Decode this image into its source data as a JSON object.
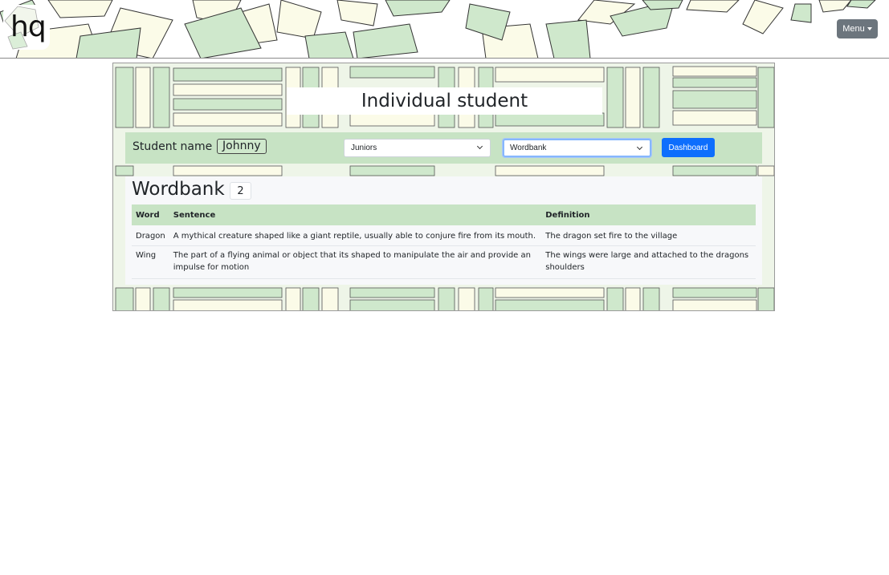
{
  "header": {
    "logo_text": "hq",
    "menu_label": "Menu"
  },
  "page": {
    "title": "Individual student"
  },
  "controls": {
    "student_label": "Student name :",
    "student_name": "Johnny",
    "group_select": "Juniors",
    "view_select": "Wordbank",
    "dashboard_label": "Dashboard"
  },
  "wordbank": {
    "title": "Wordbank",
    "count": "2",
    "columns": [
      "Word",
      "Sentence",
      "Definition"
    ],
    "rows": [
      {
        "word": "Dragon",
        "sentence": "A mythical creature shaped like a giant reptile, usually able to conjure fire from its mouth.",
        "definition": "The dragon set fire to the village"
      },
      {
        "word": "Wing",
        "sentence": "The part of a flying animal or object that its shaped to manipulate the air and provide an impulse for motion",
        "definition": "The wings were large and attached to the dragons shoulders"
      }
    ]
  },
  "colors": {
    "accent_green": "#c7e3c4",
    "primary_blue": "#0d6efd",
    "menu_gray": "#6c757d"
  }
}
